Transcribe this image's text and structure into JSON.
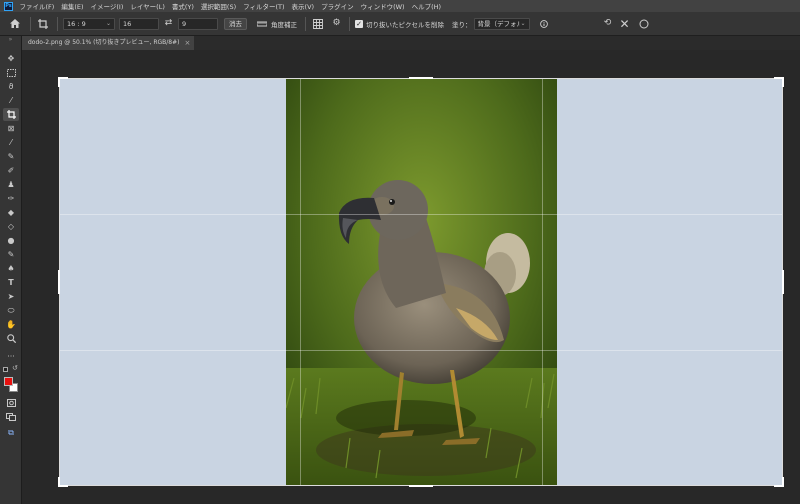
{
  "app": {
    "logo_text": "Ps"
  },
  "menubar": {
    "items": [
      "ファイル(F)",
      "編集(E)",
      "イメージ(I)",
      "レイヤー(L)",
      "書式(Y)",
      "選択範囲(S)",
      "フィルター(T)",
      "表示(V)",
      "プラグイン",
      "ウィンドウ(W)",
      "ヘルプ(H)"
    ]
  },
  "options_bar": {
    "ratio_preset": "16 : 9",
    "width_value": "16",
    "height_value": "9",
    "clear_label": "消去",
    "straighten_label": "角度補正",
    "delete_cropped_label": "切り抜いたピクセルを削除",
    "delete_cropped_checked": true,
    "fill_label": "塗り：",
    "fill_value": "背景（デフォルト）"
  },
  "document_tab": {
    "title": "dodo-2.png @ 50.1% (切り抜きプレビュー, RGB/8#)",
    "close_glyph": "×"
  },
  "colors": {
    "foreground": "#e8110f",
    "background": "#ffffff",
    "canvas_fill": "#c9d4e2",
    "ui_dark": "#282828",
    "ui_panel": "#353535"
  },
  "toolbar": {
    "tools": [
      "move-tool-icon",
      "marquee-tool-icon",
      "lasso-tool-icon",
      "magic-wand-tool-icon",
      "crop-tool-icon",
      "frame-tool-icon",
      "eyedropper-tool-icon",
      "healing-brush-tool-icon",
      "brush-tool-icon",
      "clone-stamp-tool-icon",
      "history-brush-tool-icon",
      "eraser-tool-icon",
      "paint-bucket-tool-icon",
      "blur-tool-icon",
      "dodge-tool-icon",
      "pen-tool-icon",
      "type-tool-icon",
      "path-selection-tool-icon",
      "ellipse-tool-icon",
      "hand-tool-icon",
      "zoom-tool-icon",
      "more-tools-icon"
    ],
    "active_tool": "crop-tool-icon"
  },
  "canvas": {
    "image_subject": "dodo bird standing on grass"
  }
}
